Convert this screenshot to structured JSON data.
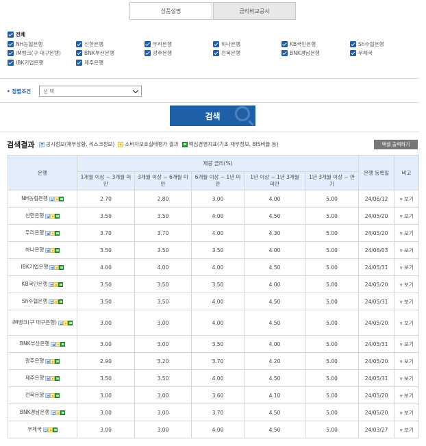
{
  "tabs": [
    "상품설명",
    "금리비교공시"
  ],
  "filters": {
    "all_label": "전체",
    "banks": [
      [
        "NH농협은행",
        "신한은행",
        "우리은행",
        "하나은행",
        "KB국민은행",
        "Sh수협은행"
      ],
      [
        "iM뱅크(구 대구은행)",
        "BNK부산은행",
        "광주은행",
        "전북은행",
        "BNK경남은행",
        "우체국"
      ],
      [
        "IBK기업은행",
        "제주은행"
      ]
    ]
  },
  "sort": {
    "label": "정렬조건",
    "value": "선 택"
  },
  "search_button": "검색",
  "results": {
    "title": "검색결과",
    "legend": [
      "공시정보(재무상황, 리스크정보)",
      "소비자보호실태평가 결과",
      "핵심경영지표(기초 재무정보, BIS비율 등)"
    ],
    "excel_button": "엑셀 출력하기"
  },
  "table": {
    "headers": {
      "bank": "은행",
      "rate_group": "제공 금리(%)",
      "date": "은행 등록일",
      "note": "비고"
    },
    "periods": [
      "1개월 이상 ~ 3개월 미만",
      "3개월 이상 ~ 6개월 미만",
      "6개월 이상 ~ 1년 미만",
      "1년 이상 ~ 1년 3개월 미만",
      "1년 3개월 이상 ~ 만기"
    ],
    "view_label": "보기",
    "rows": [
      {
        "bank": "NH농협은행",
        "rates": [
          "2.70",
          "2.80",
          "3.00",
          "4.00",
          "5.00"
        ],
        "date": "24/06/12"
      },
      {
        "bank": "신한은행",
        "rates": [
          "3.50",
          "3.50",
          "4.00",
          "4.50",
          "5.00"
        ],
        "date": "24/05/20"
      },
      {
        "bank": "우리은행",
        "rates": [
          "3.70",
          "3.70",
          "4.00",
          "4.30",
          "5.00"
        ],
        "date": "24/05/20"
      },
      {
        "bank": "하나은행",
        "rates": [
          "3.50",
          "3.50",
          "3.50",
          "4.00",
          "5.00"
        ],
        "date": "24/06/03"
      },
      {
        "bank": "IBK기업은행",
        "rates": [
          "4.00",
          "4.00",
          "4.00",
          "4.50",
          "5.00"
        ],
        "date": "24/05/31"
      },
      {
        "bank": "KB국민은행",
        "rates": [
          "3.50",
          "3.50",
          "3.50",
          "4.00",
          "5.00"
        ],
        "date": "24/05/20"
      },
      {
        "bank": "Sh수협은행",
        "rates": [
          "3.50",
          "3.50",
          "4.00",
          "4.50",
          "5.00"
        ],
        "date": "24/05/31"
      },
      {
        "bank": "iM뱅크(구 대구은행)",
        "rates": [
          "3.00",
          "3.00",
          "4.00",
          "4.50",
          "5.00"
        ],
        "date": "24/05/20"
      },
      {
        "bank": "BNK부산은행",
        "rates": [
          "3.00",
          "3.00",
          "3.50",
          "4.00",
          "5.00"
        ],
        "date": "24/05/31"
      },
      {
        "bank": "광주은행",
        "rates": [
          "2.90",
          "3.20",
          "3.70",
          "4.20",
          "5.00"
        ],
        "date": "24/05/20"
      },
      {
        "bank": "제주은행",
        "rates": [
          "3.50",
          "3.50",
          "4.00",
          "4.50",
          "5.00"
        ],
        "date": "24/05/31"
      },
      {
        "bank": "전북은행",
        "rates": [
          "3.00",
          "3.00",
          "3.60",
          "4.10",
          "5.00"
        ],
        "date": "24/05/20"
      },
      {
        "bank": "BNK경남은행",
        "rates": [
          "3.00",
          "3.00",
          "3.70",
          "4.50",
          "5.00"
        ],
        "date": "24/05/20"
      },
      {
        "bank": "우체국",
        "rates": [
          "3.00",
          "3.00",
          "4.00",
          "4.50",
          "5.00"
        ],
        "date": "24/03/27"
      }
    ]
  }
}
